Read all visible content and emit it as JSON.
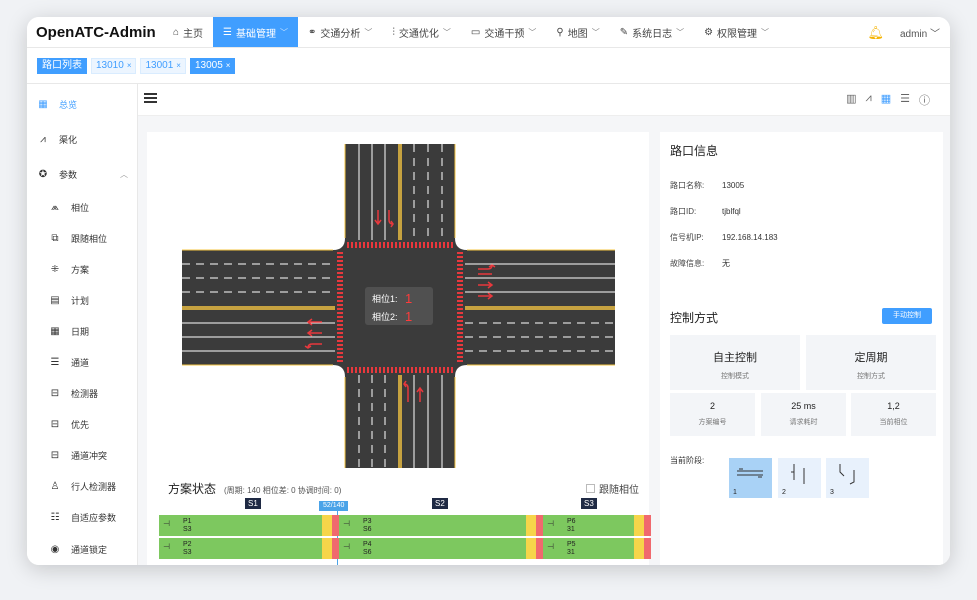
{
  "app": {
    "title": "OpenATC-Admin"
  },
  "nav": [
    {
      "label": "主页",
      "icon": "home-icon",
      "glyph": "⌂"
    },
    {
      "label": "基础管理",
      "icon": "layers-icon",
      "glyph": "☰",
      "active": true
    },
    {
      "label": "交通分析",
      "icon": "route-icon",
      "glyph": "⚭"
    },
    {
      "label": "交通优化",
      "icon": "sliders-icon",
      "glyph": "⫶"
    },
    {
      "label": "交通干预",
      "icon": "camera-icon",
      "glyph": "▭"
    },
    {
      "label": "地图",
      "icon": "map-pin-icon",
      "glyph": "⚲"
    },
    {
      "label": "系统日志",
      "icon": "pen-icon",
      "glyph": "✎"
    },
    {
      "label": "权限管理",
      "icon": "gear-icon",
      "glyph": "⚙"
    }
  ],
  "user": {
    "name": "admin"
  },
  "tabs": [
    {
      "label": "路口列表",
      "solid": true,
      "closable": false
    },
    {
      "label": "13010",
      "solid": false,
      "closable": true
    },
    {
      "label": "13001",
      "solid": false,
      "closable": true
    },
    {
      "label": "13005",
      "solid": true,
      "closable": true
    }
  ],
  "sidebar": {
    "items": [
      {
        "label": "总览",
        "icon": "grid-icon",
        "glyph": "▦",
        "level": "top",
        "active": true
      },
      {
        "label": "渠化",
        "icon": "road-icon",
        "glyph": "⩘",
        "level": "top"
      },
      {
        "label": "参数",
        "icon": "settings-icon",
        "glyph": "✪",
        "level": "top",
        "expanded": true
      },
      {
        "label": "相位",
        "icon": "phase-icon",
        "glyph": "⩕",
        "level": "sub"
      },
      {
        "label": "跟随相位",
        "icon": "follow-phase-icon",
        "glyph": "⧉",
        "level": "sub"
      },
      {
        "label": "方案",
        "icon": "plan-icon",
        "glyph": "⁜",
        "level": "sub"
      },
      {
        "label": "计划",
        "icon": "schedule-icon",
        "glyph": "▤",
        "level": "sub"
      },
      {
        "label": "日期",
        "icon": "calendar-icon",
        "glyph": "▦",
        "level": "sub"
      },
      {
        "label": "通道",
        "icon": "channel-icon",
        "glyph": "☰",
        "level": "sub"
      },
      {
        "label": "检测器",
        "icon": "detector-icon",
        "glyph": "⊟",
        "level": "sub"
      },
      {
        "label": "优先",
        "icon": "priority-icon",
        "glyph": "⊟",
        "level": "sub"
      },
      {
        "label": "通道冲突",
        "icon": "conflict-icon",
        "glyph": "⊟",
        "level": "sub"
      },
      {
        "label": "行人检测器",
        "icon": "pedestrian-icon",
        "glyph": "♙",
        "level": "sub"
      },
      {
        "label": "自适应参数",
        "icon": "adaptive-icon",
        "glyph": "☷",
        "level": "sub"
      },
      {
        "label": "通道锁定",
        "icon": "lock-icon",
        "glyph": "◉",
        "level": "sub"
      }
    ]
  },
  "intersection": {
    "phase_labels": [
      {
        "label": "相位1:",
        "value": "1"
      },
      {
        "label": "相位2:",
        "value": "1"
      }
    ]
  },
  "plan": {
    "title": "方案状态",
    "subtitle": "(周期: 140 相位差: 0 协调时间: 0)",
    "follow_label": "跟随相位",
    "cursor_label": "52/140",
    "stages": [
      "S1",
      "S2",
      "S3"
    ],
    "rings": [
      [
        {
          "name": "P1",
          "split": "S3",
          "green": 0.34,
          "yellow": 0.02,
          "red": 0.015
        },
        {
          "name": "P3",
          "split": "S6",
          "green": 0.39,
          "yellow": 0.02,
          "red": 0.015
        },
        {
          "name": "P6",
          "split": "31",
          "green": 0.19,
          "yellow": 0.02,
          "red": 0.015
        }
      ],
      [
        {
          "name": "P2",
          "split": "S3",
          "green": 0.34,
          "yellow": 0.02,
          "red": 0.015
        },
        {
          "name": "P4",
          "split": "S6",
          "green": 0.39,
          "yellow": 0.02,
          "red": 0.015
        },
        {
          "name": "P5",
          "split": "31",
          "green": 0.19,
          "yellow": 0.02,
          "red": 0.015
        }
      ]
    ]
  },
  "info": {
    "title": "路口信息",
    "rows": [
      {
        "key": "路口名称:",
        "value": "13005"
      },
      {
        "key": "路口ID:",
        "value": "tjblfql"
      },
      {
        "key": "信号机IP:",
        "value": "192.168.14.183"
      },
      {
        "key": "故障信息:",
        "value": "无"
      }
    ]
  },
  "control": {
    "title": "控制方式",
    "manual_button": "手动控制",
    "cards_top": [
      {
        "value": "自主控制",
        "label": "控制模式"
      },
      {
        "value": "定周期",
        "label": "控制方式"
      }
    ],
    "cards_bottom": [
      {
        "value": "2",
        "label": "方案编号"
      },
      {
        "value": "25 ms",
        "label": "请求耗时"
      },
      {
        "value": "1,2",
        "label": "当前相位"
      }
    ],
    "stage_label": "当前阶段:",
    "stages": [
      "1",
      "2",
      "3"
    ]
  },
  "colors": {
    "accent": "#409eff",
    "green": "#7dc85f",
    "yellow": "#f6d54a",
    "red": "#f0696e",
    "road": "#3b3b3b",
    "stop_line": "#e8383d"
  }
}
